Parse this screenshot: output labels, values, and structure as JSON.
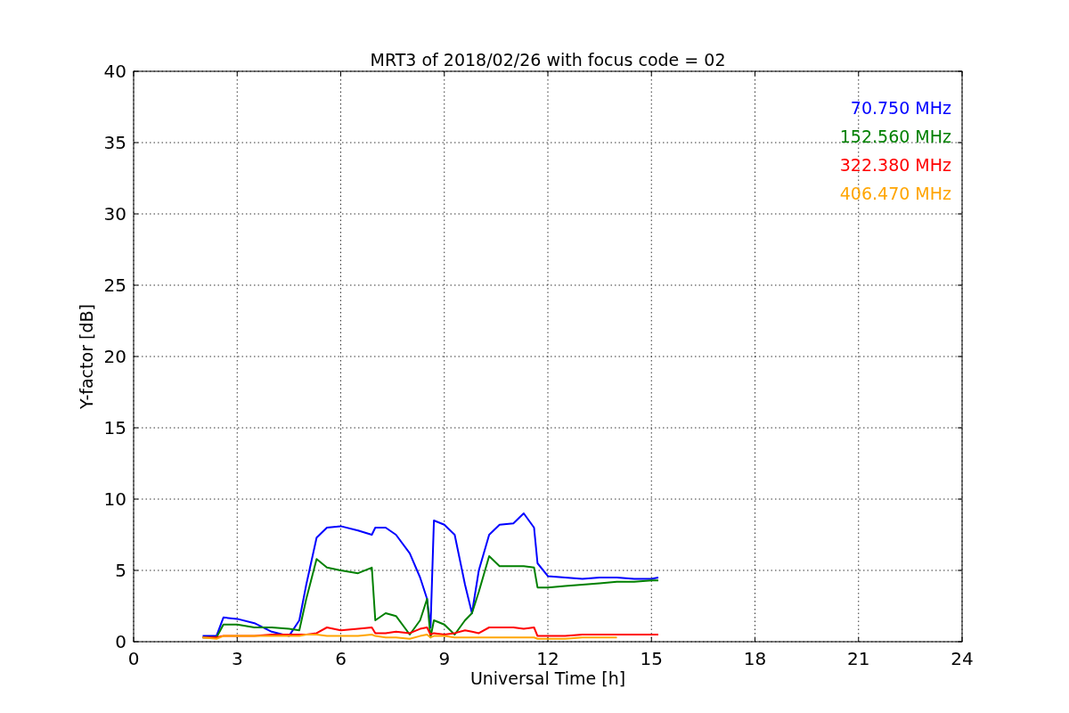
{
  "figure": {
    "chart_data": {
      "type": "line",
      "title": "MRT3 of 2018/02/26 with focus code = 02",
      "xlabel": "Universal Time [h]",
      "ylabel": "Y-factor [dB]",
      "x": [
        2.0,
        2.4,
        2.6,
        3.0,
        3.5,
        4.0,
        4.5,
        4.8,
        5.0,
        5.3,
        5.6,
        6.0,
        6.5,
        6.9,
        7.0,
        7.3,
        7.6,
        8.0,
        8.3,
        8.5,
        8.6,
        8.7,
        9.0,
        9.3,
        9.6,
        9.8,
        10.0,
        10.3,
        10.6,
        11.0,
        11.3,
        11.6,
        11.7,
        12.0,
        12.5,
        13.0,
        13.5,
        14.0,
        14.5,
        15.0,
        15.2
      ],
      "series": [
        {
          "name": "70.750 MHz",
          "color": "#0000ff",
          "values": [
            0.4,
            0.4,
            1.7,
            1.6,
            1.3,
            0.7,
            0.4,
            1.5,
            4.0,
            7.3,
            8.0,
            8.1,
            7.8,
            7.5,
            8.0,
            8.0,
            7.5,
            6.2,
            4.5,
            3.0,
            1.0,
            8.5,
            8.2,
            7.5,
            4.0,
            2.0,
            5.0,
            7.5,
            8.2,
            8.3,
            9.0,
            8.0,
            5.5,
            4.6,
            4.5,
            4.4,
            4.5,
            4.5,
            4.4,
            4.4,
            4.5
          ]
        },
        {
          "name": "152.560 MHz",
          "color": "#008000",
          "values": [
            0.3,
            0.3,
            1.2,
            1.2,
            1.0,
            1.0,
            0.9,
            0.8,
            3.0,
            5.8,
            5.2,
            5.0,
            4.8,
            5.2,
            1.5,
            2.0,
            1.8,
            0.5,
            1.5,
            3.0,
            0.3,
            1.5,
            1.2,
            0.5,
            1.5,
            2.0,
            3.5,
            6.0,
            5.3,
            5.3,
            5.3,
            5.2,
            3.8,
            3.8,
            3.9,
            4.0,
            4.1,
            4.2,
            4.2,
            4.3,
            4.3
          ]
        },
        {
          "name": "322.380 MHz",
          "color": "#ff0000",
          "values": [
            0.3,
            0.3,
            0.4,
            0.4,
            0.4,
            0.5,
            0.5,
            0.5,
            0.5,
            0.6,
            1.0,
            0.8,
            0.9,
            1.0,
            0.6,
            0.6,
            0.7,
            0.6,
            0.9,
            1.0,
            0.5,
            0.6,
            0.5,
            0.6,
            0.8,
            0.7,
            0.6,
            1.0,
            1.0,
            1.0,
            0.9,
            1.0,
            0.4,
            0.4,
            0.4,
            0.5,
            0.5,
            0.5,
            0.5,
            0.5,
            0.5
          ]
        },
        {
          "name": "406.470 MHz",
          "color": "#ffa500",
          "values": [
            0.3,
            0.2,
            0.4,
            0.4,
            0.4,
            0.4,
            0.4,
            0.4,
            0.5,
            0.5,
            0.4,
            0.4,
            0.4,
            0.5,
            0.4,
            0.3,
            0.3,
            0.2,
            0.4,
            0.5,
            0.3,
            0.4,
            0.4,
            0.3,
            0.3,
            0.3,
            0.3,
            0.3,
            0.3,
            0.3,
            0.3,
            0.3,
            0.2,
            0.2,
            0.2,
            0.3,
            0.3,
            0.3,
            null,
            null,
            null
          ]
        }
      ],
      "grid": true,
      "xlim": [
        0,
        24
      ],
      "ylim": [
        0,
        40
      ],
      "xticks": [
        0,
        3,
        6,
        9,
        12,
        15,
        18,
        21,
        24
      ],
      "yticks": [
        0,
        5,
        10,
        15,
        20,
        25,
        30,
        35,
        40
      ]
    }
  }
}
